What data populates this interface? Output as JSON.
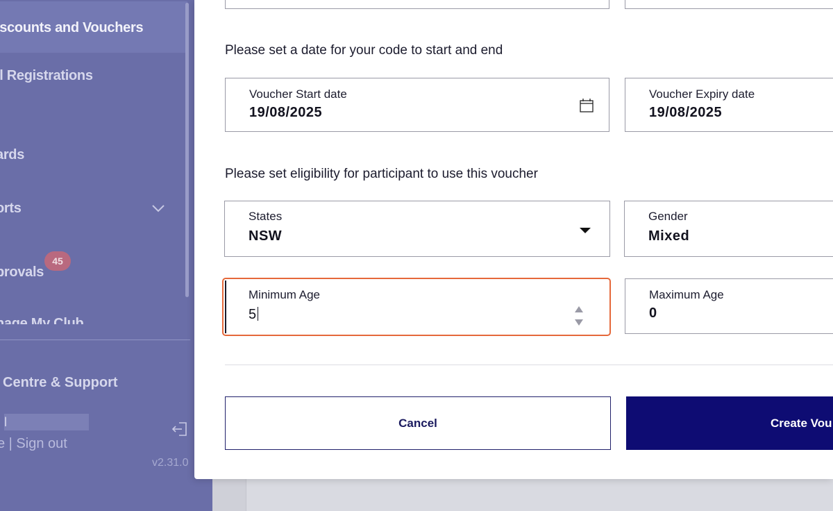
{
  "sidebar": {
    "items": [
      {
        "label": "iscounts and Vouchers",
        "active": true
      },
      {
        "label": "ll Registrations"
      },
      {
        "label": "ards"
      },
      {
        "label": "orts"
      },
      {
        "label": "provals"
      },
      {
        "label": "nage My Club"
      }
    ],
    "approvals_badge": "45",
    "help_label": "Centre & Support",
    "user_initial": "l",
    "profile_signout": "e | Sign out",
    "version": "v2.31.0"
  },
  "modal": {
    "dates_heading": "Please set a date for your code to start and end",
    "start_date": {
      "label": "Voucher Start date",
      "value": "19/08/2025"
    },
    "expiry_date": {
      "label": "Voucher Expiry date",
      "value": "19/08/2025"
    },
    "eligibility_heading": "Please set eligibility for participant to use this voucher",
    "states": {
      "label": "States",
      "value": "NSW"
    },
    "gender": {
      "label": "Gender",
      "value": "Mixed"
    },
    "min_age": {
      "label": "Minimum Age",
      "value": "5"
    },
    "max_age": {
      "label": "Maximum Age",
      "value": "0"
    },
    "cancel_label": "Cancel",
    "create_label": "Create Vou"
  },
  "colors": {
    "sidebar": "#6a6ea8",
    "primary_button": "#0e0c73",
    "focus_ring": "#e5683a",
    "badge": "#b9697f"
  }
}
